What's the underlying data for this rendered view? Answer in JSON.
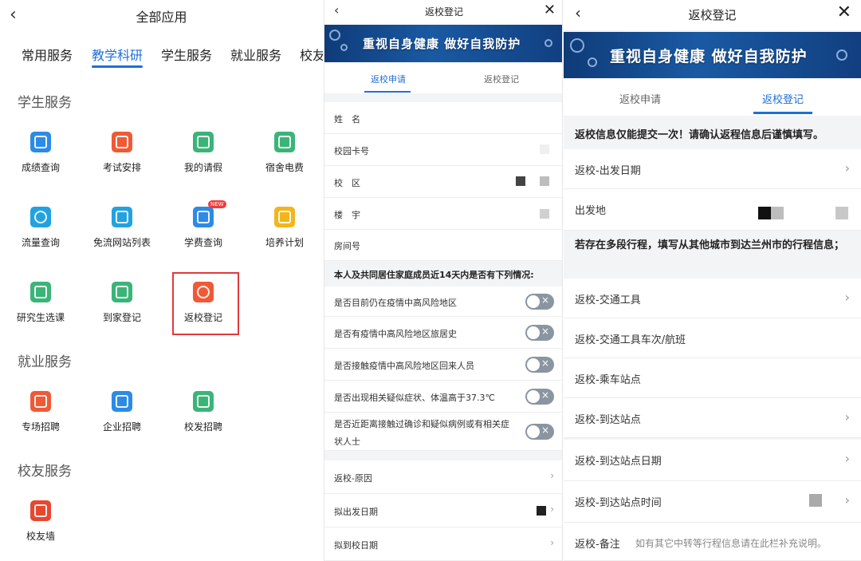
{
  "panel1": {
    "title": "全部应用",
    "back_icon": "chevron-left-icon",
    "tabs": [
      "常用服务",
      "教学科研",
      "学生服务",
      "就业服务",
      "校友"
    ],
    "active_tab": "教学科研",
    "sections": {
      "student": "学生服务",
      "employment": "就业服务",
      "alumni": "校友服务"
    },
    "apps": {
      "grades": "成绩查询",
      "exam": "考试安排",
      "leave": "我的请假",
      "dorm_power": "宿舍电费",
      "traffic": "流量查询",
      "free_sites": "免流网站列表",
      "tuition": "学费查询",
      "training_plan": "培养计划",
      "grad_course": "研究生选课",
      "home_reg": "到家登记",
      "return_reg": "返校登记",
      "job_fair": "专场招聘",
      "company_jobs": "企业招聘",
      "campus_jobs": "校发招聘",
      "alumni_wall": "校友墙"
    },
    "new_badge": "NEW",
    "highlight_color": "#e03a3a"
  },
  "panel2": {
    "title": "返校登记",
    "banner": "重视自身健康   做好自我防护",
    "tabs": [
      "返校申请",
      "返校登记"
    ],
    "active_tab": "返校申请",
    "fields": {
      "name": "姓　名",
      "card": "校园卡号",
      "campus": "校　区",
      "building": "楼　宇",
      "room": "房间号"
    },
    "question_header": "本人及共同居住家庭成员近14天内是否有下列情况:",
    "questions": {
      "q1": "是否目前仍在疫情中高风险地区",
      "q2": "是否有疫情中高风险地区旅居史",
      "q3": "是否接触疫情中高风险地区回来人员",
      "q4": "是否出现相关疑似症状、体温高于37.3℃",
      "q5a": "是否近距离接触过确诊和疑似病例或有相关症",
      "q5b": "状人士"
    },
    "bottom": {
      "reason": "返校-原因",
      "depart_date": "拟出发日期",
      "arrive_date": "拟到校日期"
    }
  },
  "panel3": {
    "title": "返校登记",
    "banner": "重视自身健康   做好自我防护",
    "tabs": [
      "返校申请",
      "返校登记"
    ],
    "active_tab": "返校登记",
    "warning": "返校信息仅能提交一次！请确认返程信息后谨慎填写。",
    "multi_note": "若存在多段行程，填写从其他城市到达兰州市的行程信息；",
    "rows": {
      "depart_date": "返校-出发日期",
      "origin": "出发地",
      "transport": "返校-交通工具",
      "transport_no": "返校-交通工具车次/航班",
      "board_station": "返校-乘车站点",
      "arrive_station": "返校-到达站点",
      "arrive_date": "返校-到达站点日期",
      "arrive_time": "返校-到达站点时间",
      "remark": "返校-备注",
      "remark_hint": "如有其它中转等行程信息请在此栏补充说明。"
    }
  },
  "colors": {
    "accent": "#1f6fd6",
    "banner": "#123f7e"
  }
}
